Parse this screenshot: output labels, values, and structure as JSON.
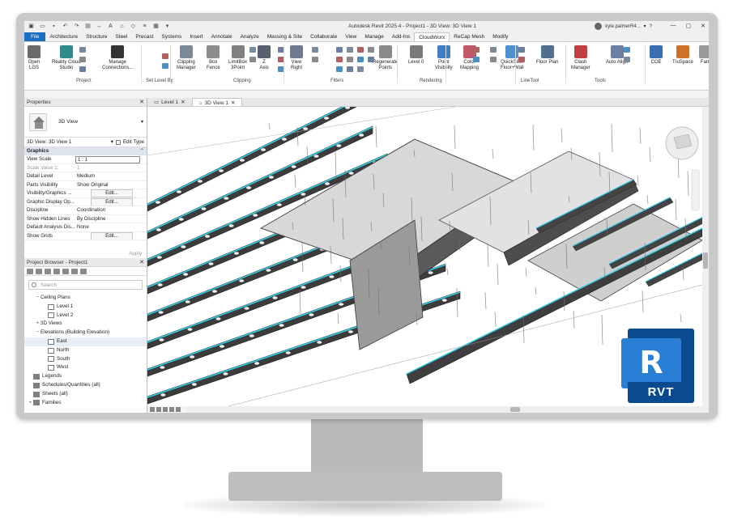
{
  "window": {
    "title": "Autodesk Revit 2025.4 - Project1 - 3D View: 3D View 1",
    "user": "kyle.palmerR4...",
    "help": "?"
  },
  "ribbon_tabs": [
    "File",
    "Architecture",
    "Structure",
    "Steel",
    "Precast",
    "Systems",
    "Insert",
    "Annotate",
    "Analyze",
    "Massing & Site",
    "Collaborate",
    "View",
    "Manage",
    "Add-Ins",
    "CloudWorx",
    "ReCap Mesh",
    "Modify"
  ],
  "ribbon": {
    "buttons": [
      {
        "label": "Open\nLGS"
      },
      {
        "label": "Reality Cloud\nStudio"
      },
      {
        "label": "Manage\nConnections..."
      },
      {
        "label": "Clipping\nManager"
      },
      {
        "label": "Box\nFence"
      },
      {
        "label": "LimitBox\n3Point"
      },
      {
        "label": "Z\nAxis"
      },
      {
        "label": "View\nRight"
      },
      {
        "label": "Regenerate\nPoints"
      },
      {
        "label": "Level 0"
      },
      {
        "label": "Point\nVisibility"
      },
      {
        "label": "Color\nMapping"
      },
      {
        "label": "QuickSlice\nFloor+Wall"
      },
      {
        "label": "Floor Plan"
      },
      {
        "label": "Clash\nManager"
      },
      {
        "label": "Auto Align"
      },
      {
        "label": "COE"
      },
      {
        "label": "TruSpace"
      },
      {
        "label": "Fam"
      }
    ],
    "groups": [
      "Project",
      "Set Level By",
      "Clipping",
      "Filters",
      "Rendering",
      "LineTool",
      "Tools"
    ]
  },
  "properties": {
    "title": "Properties",
    "type_name": "3D View",
    "view_selector": "3D View: 3D View 1",
    "edit_type": "Edit Type",
    "section": "Graphics",
    "rows": [
      {
        "k": "View Scale",
        "v": "1 : 1",
        "style": "box"
      },
      {
        "k": "Scale Value    1:",
        "v": "1",
        "style": "muted"
      },
      {
        "k": "Detail Level",
        "v": "Medium",
        "style": ""
      },
      {
        "k": "Parts Visibility",
        "v": "Show Original",
        "style": ""
      },
      {
        "k": "Visibility/Graphics ...",
        "v": "Edit...",
        "style": "btn"
      },
      {
        "k": "Graphic Display Op...",
        "v": "Edit...",
        "style": "btn"
      },
      {
        "k": "Discipline",
        "v": "Coordination",
        "style": ""
      },
      {
        "k": "Show Hidden Lines",
        "v": "By Discipline",
        "style": ""
      },
      {
        "k": "Default Analysis Dis...",
        "v": "None",
        "style": ""
      },
      {
        "k": "Show Grids",
        "v": "Edit...",
        "style": "btn"
      }
    ],
    "apply": "Apply"
  },
  "project_browser": {
    "title": "Project Browser - Project1",
    "search_placeholder": "Search",
    "items": [
      {
        "label": "Ceiling Plans",
        "indent": 1,
        "toggle": "−",
        "icon": "none"
      },
      {
        "label": "Level 1",
        "indent": 2,
        "toggle": "",
        "icon": "view"
      },
      {
        "label": "Level 2",
        "indent": 2,
        "toggle": "",
        "icon": "view"
      },
      {
        "label": "3D Views",
        "indent": 1,
        "toggle": "+",
        "icon": "none"
      },
      {
        "label": "Elevations (Building Elevation)",
        "indent": 1,
        "toggle": "−",
        "icon": "none"
      },
      {
        "label": "East",
        "indent": 2,
        "toggle": "",
        "icon": "view",
        "selected": true
      },
      {
        "label": "North",
        "indent": 2,
        "toggle": "",
        "icon": "view"
      },
      {
        "label": "South",
        "indent": 2,
        "toggle": "",
        "icon": "view"
      },
      {
        "label": "West",
        "indent": 2,
        "toggle": "",
        "icon": "view"
      },
      {
        "label": "Legends",
        "indent": 0,
        "toggle": "",
        "icon": "folder"
      },
      {
        "label": "Schedules/Quantities (all)",
        "indent": 0,
        "toggle": "",
        "icon": "folder"
      },
      {
        "label": "Sheets (all)",
        "indent": 0,
        "toggle": "",
        "icon": "folder"
      },
      {
        "label": "Families",
        "indent": 0,
        "toggle": "+",
        "icon": "folder"
      }
    ]
  },
  "view_tabs": [
    {
      "label": "Level 1",
      "active": false
    },
    {
      "label": "3D View 1",
      "active": true
    }
  ],
  "badge": {
    "letter": "R",
    "label": "RVT"
  },
  "colors": {
    "file_tab": "#1b6fc2",
    "badge_dark": "#0a4b8f",
    "badge_light": "#2a7fd4",
    "cyan": "#35d0e6"
  }
}
